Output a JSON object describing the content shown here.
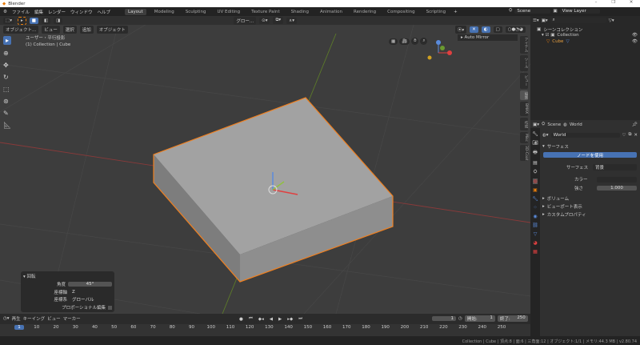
{
  "window": {
    "title": "Blender",
    "controls": [
      "–",
      "❐",
      "✕"
    ]
  },
  "menu": [
    "ファイル",
    "編集",
    "レンダー",
    "ウィンドウ",
    "ヘルプ"
  ],
  "workspaces": [
    {
      "label": "Layout",
      "active": true
    },
    {
      "label": "Modeling"
    },
    {
      "label": "Sculpting"
    },
    {
      "label": "UV Editing"
    },
    {
      "label": "Texture Paint"
    },
    {
      "label": "Shading"
    },
    {
      "label": "Animation"
    },
    {
      "label": "Rendering"
    },
    {
      "label": "Compositing"
    },
    {
      "label": "Scripting"
    }
  ],
  "scene": {
    "name": "Scene",
    "view_layer": "View Layer"
  },
  "viewport": {
    "mode": "オブジェクト...",
    "menus": [
      "ビュー",
      "選択",
      "追加",
      "オブジェクト"
    ],
    "orientation": "グロー...",
    "view_name": "ユーザー・平行投影",
    "context": "(1) Collection | Cube",
    "auto_mirror": "Auto Mirror",
    "side_tabs": [
      "アイテム",
      "ツール",
      "ビュー",
      "編集",
      "BMAX",
      "作成",
      "Misc",
      "3D-Coat"
    ]
  },
  "operator_panel": {
    "title": "回転",
    "angle_label": "角度",
    "angle": "45°",
    "axis_label": "座標軸",
    "axis": "Z",
    "orient_label": "座標系",
    "orient": "グローバル",
    "proportional_label": "プロポーショナル編集"
  },
  "outliner": {
    "root": "シーンコレクション",
    "items": [
      "Collection",
      "Cube"
    ]
  },
  "properties": {
    "scene": "Scene",
    "world": "World",
    "world_name": "World",
    "surface_panel": "サーフェス",
    "use_nodes": "ノードを使用",
    "surface_label": "サーフェス",
    "surface_value": "背景",
    "color_label": "カラー",
    "strength_label": "強さ",
    "strength": "1.000",
    "panels": [
      "ボリューム",
      "ビューポート表示",
      "カスタムプロパティ"
    ]
  },
  "timeline": {
    "menus": [
      "再生",
      "キーイング",
      "ビュー",
      "マーカー"
    ],
    "current_frame": "1",
    "start_label": "開始:",
    "start": "1",
    "end_label": "終了:",
    "end": "250",
    "ticks": [
      "1",
      "10",
      "20",
      "30",
      "40",
      "50",
      "60",
      "70",
      "80",
      "90",
      "100",
      "110",
      "120",
      "130",
      "140",
      "150",
      "160",
      "170",
      "180",
      "190",
      "200",
      "210",
      "220",
      "230",
      "240",
      "250"
    ]
  },
  "status": "Collection | Cube | 頂点:8 | 面:6 | 三角面:12 | オブジェクト:1/1 | メモリ:44.3 MB | v2.80.74",
  "colors": {
    "accent": "#4772b3",
    "selection": "#f08020"
  }
}
